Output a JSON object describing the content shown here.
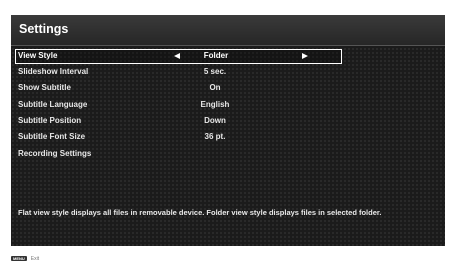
{
  "header": {
    "title": "Settings"
  },
  "settings": {
    "items": [
      {
        "label": "View Style",
        "value": "Folder",
        "selected": true
      },
      {
        "label": "Slideshow Interval",
        "value": "5 sec."
      },
      {
        "label": "Show Subtitle",
        "value": "On"
      },
      {
        "label": "Subtitle Language",
        "value": "English"
      },
      {
        "label": "Subtitle Position",
        "value": "Down"
      },
      {
        "label": "Subtitle Font Size",
        "value": "36 pt."
      },
      {
        "label": "Recording Settings",
        "value": ""
      }
    ]
  },
  "info": {
    "text": "Flat view style displays all files in removable device. Folder view style displays files in selected folder."
  },
  "footer": {
    "key_label": "MENU",
    "exit_label": "Exit"
  },
  "colors": {
    "background": "#1b1b1b",
    "text": "#e8e8e8",
    "selection_border": "#ffffff"
  },
  "icons": {
    "left": "left-triangle-arrow",
    "right": "right-triangle-arrow"
  }
}
